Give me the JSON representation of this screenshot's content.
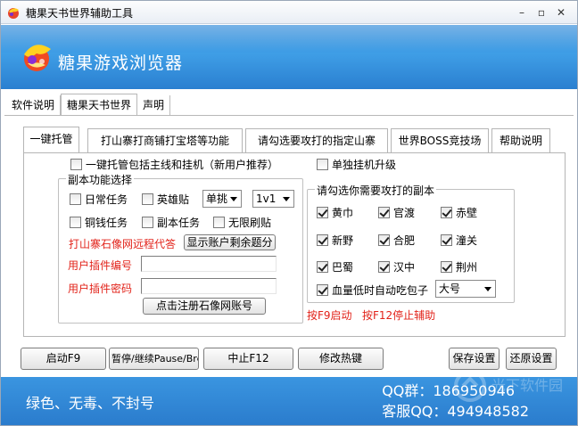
{
  "window": {
    "title": "糖果天书世界辅助工具",
    "controls": {
      "minimize": "–",
      "restore": "▫",
      "close": "✕"
    }
  },
  "banner": {
    "title": "糖果游戏浏览器"
  },
  "top_tabs": [
    {
      "label": "软件说明",
      "active": false
    },
    {
      "label": "糖果天书世界",
      "active": true
    },
    {
      "label": "声明",
      "active": false
    }
  ],
  "inner_tabs": [
    {
      "label": "一键托管",
      "active": true
    },
    {
      "label": "打山寨打商铺打宝塔等功能",
      "active": false
    },
    {
      "label": "请勾选要攻打的指定山寨",
      "active": false
    },
    {
      "label": "世界BOSS竞技场",
      "active": false
    },
    {
      "label": "帮助说明",
      "active": false
    }
  ],
  "options": {
    "main_line": {
      "label": "一键托管包括主线和挂机（新用户推荐）",
      "checked": false
    },
    "solo_idle": {
      "label": "单独挂机升级",
      "checked": false
    }
  },
  "dungeon_group": {
    "title": "副本功能选择",
    "daily": {
      "label": "日常任务",
      "checked": false
    },
    "hero": {
      "label": "英雄贴",
      "checked": false
    },
    "mode_select": "单挑",
    "vs_select": "1v1",
    "coin": {
      "label": "铜钱任务",
      "checked": false
    },
    "dungeon_task": {
      "label": "副本任务",
      "checked": false
    },
    "infinite": {
      "label": "无限刷贴",
      "checked": false
    },
    "remote_text": "打山寨石像网远程代答",
    "show_remaining_button": "显示账户剩余题分",
    "plugin_id_label": "用户插件编号",
    "plugin_id_value": "",
    "plugin_pwd_label": "用户插件密码",
    "plugin_pwd_value": "",
    "register_button": "点击注册石像网账号"
  },
  "target_group": {
    "title": "请勾选你需要攻打的副本",
    "items": [
      {
        "label": "黄巾",
        "checked": true
      },
      {
        "label": "官渡",
        "checked": true
      },
      {
        "label": "赤壁",
        "checked": true
      },
      {
        "label": "新野",
        "checked": true
      },
      {
        "label": "合肥",
        "checked": true
      },
      {
        "label": "潼关",
        "checked": true
      },
      {
        "label": "巴蜀",
        "checked": true
      },
      {
        "label": "汉中",
        "checked": true
      },
      {
        "label": "荆州",
        "checked": true
      }
    ],
    "potion": {
      "label": "血量低时自动吃包子",
      "checked": true
    },
    "potion_size": "大号"
  },
  "hotkey_hint": "按F9启动   按F12停止辅助",
  "buttons": {
    "start": "启动F9",
    "pause": "暂停/继续Pause/Break",
    "stop": "中止F12",
    "hotkey": "修改热键",
    "save": "保存设置",
    "restore": "还原设置"
  },
  "footer": {
    "slogan": "绿色、无毒、不封号",
    "qq_group": "QQ群：186950946",
    "support_qq": "客服QQ：494948582"
  },
  "watermark": "光下软件园",
  "colors": {
    "banner_blue": "#2f8ad9",
    "footer_blue": "#2a7bcc",
    "red_text": "#e2231a"
  }
}
